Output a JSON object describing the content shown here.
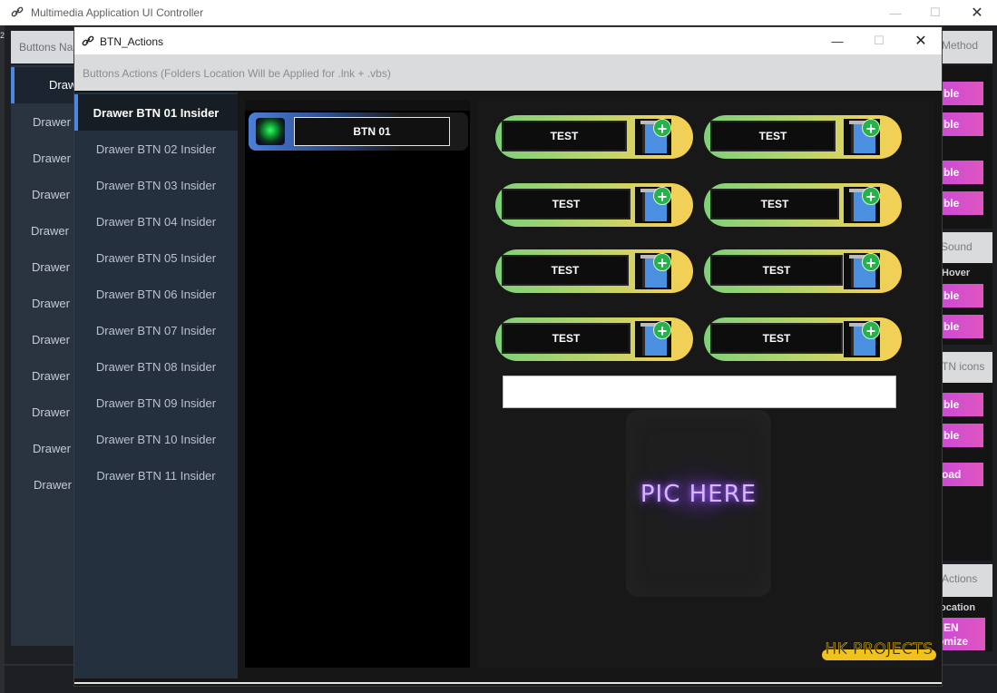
{
  "bg_window": {
    "title": "Multimedia Application UI Controller",
    "tab_label": "Buttons Na",
    "sidebar": [
      {
        "label": "Draw",
        "active": true
      },
      {
        "label": "Drawer"
      },
      {
        "label": "Drawer"
      },
      {
        "label": "Drawer"
      },
      {
        "label": "Drawer"
      },
      {
        "label": "Drawer"
      },
      {
        "label": "Drawer"
      },
      {
        "label": "Drawer"
      },
      {
        "label": "Drawer"
      },
      {
        "label": "Drawer"
      },
      {
        "label": "Drawer"
      },
      {
        "label": "Drawer"
      }
    ],
    "right": {
      "method_label": "Method",
      "pink1": "ble",
      "pink2": "ble",
      "pink3": "ble",
      "pink4": "ble",
      "sound_label": "Sound",
      "hover_label": "Hover",
      "pink5": "ble",
      "pink6": "ble",
      "icons_label": "TN icons",
      "pink7": "ble",
      "pink8": "ble",
      "pink9": "oad",
      "actions_label": "Actions",
      "location_label": "ocation",
      "pink10_line1": "EN",
      "pink10_line2": "omize"
    }
  },
  "fg_window": {
    "title": "BTN_Actions",
    "description": "Buttons Actions (Folders Location Will be Applied for .lnk + .vbs)",
    "sidebar": [
      {
        "label": "Drawer BTN 01 Insider",
        "active": true
      },
      {
        "label": "Drawer BTN 02 Insider"
      },
      {
        "label": "Drawer BTN 03 Insider"
      },
      {
        "label": "Drawer BTN 04 Insider"
      },
      {
        "label": "Drawer BTN 05 Insider"
      },
      {
        "label": "Drawer BTN 06 Insider"
      },
      {
        "label": "Drawer BTN 07 Insider"
      },
      {
        "label": "Drawer BTN 08 Insider"
      },
      {
        "label": "Drawer BTN 09 Insider"
      },
      {
        "label": "Drawer BTN 10 Insider"
      },
      {
        "label": "Drawer BTN 11 Insider"
      }
    ],
    "btn_list": [
      {
        "label": "BTN 01"
      }
    ],
    "test_buttons": [
      {
        "label": "TEST"
      },
      {
        "label": "TEST"
      },
      {
        "label": "TEST"
      },
      {
        "label": "TEST"
      },
      {
        "label": "TEST"
      },
      {
        "label": "TEST"
      },
      {
        "label": "TEST"
      },
      {
        "label": "TEST"
      }
    ],
    "path_field": {
      "value": ""
    },
    "picture_placeholder": "PIC HERE",
    "logo_text": "HK PROJECTS"
  },
  "colors": {
    "accent_blue": "#4f86e0",
    "pill_green": "#7fd07a",
    "pill_yellow": "#f4cf55",
    "pink": "#d84fcc",
    "logo_yellow": "#f1c21b"
  }
}
